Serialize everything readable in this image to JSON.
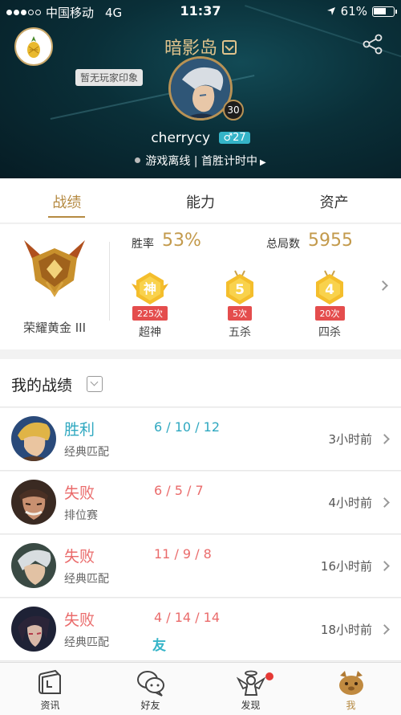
{
  "status_bar": {
    "carrier": "中国移动",
    "network": "4G",
    "time": "11:37",
    "battery": "61%"
  },
  "profile": {
    "player_name": "暗影岛",
    "impression_tag": "暂无玩家印象",
    "level": "30",
    "username": "cherrycy",
    "gender_symbol": "♂",
    "age": "27",
    "status_text": "游戏离线 | 首胜计时中"
  },
  "tabs": [
    {
      "label": "战绩"
    },
    {
      "label": "能力"
    },
    {
      "label": "资产"
    }
  ],
  "summary": {
    "rank_name": "荣耀黄金 III",
    "win_rate_label": "胜率",
    "win_rate": "53%",
    "total_games_label": "总局数",
    "total_games": "5955",
    "medals": [
      {
        "glyph": "神",
        "count": "225次",
        "label": "超神"
      },
      {
        "glyph": "5",
        "count": "5次",
        "label": "五杀"
      },
      {
        "glyph": "4",
        "count": "20次",
        "label": "四杀"
      }
    ]
  },
  "records": {
    "title": "我的战绩",
    "matches": [
      {
        "result": "胜利",
        "mode": "经典匹配",
        "kda": "6 / 10 / 12",
        "time": "3小时前"
      },
      {
        "result": "失败",
        "mode": "排位赛",
        "kda": "6 / 5 / 7",
        "time": "4小时前"
      },
      {
        "result": "失败",
        "mode": "经典匹配",
        "kda": "11 / 9 / 8",
        "time": "16小时前"
      },
      {
        "result": "失败",
        "mode": "经典匹配",
        "kda": "4 / 14 / 14",
        "time": "18小时前",
        "tag": "友"
      }
    ]
  },
  "bottom_nav": [
    {
      "label": "资讯",
      "icon": "news-book-icon"
    },
    {
      "label": "好友",
      "icon": "friends-chat-icon"
    },
    {
      "label": "发现",
      "icon": "discover-angel-icon"
    },
    {
      "label": "我",
      "icon": "me-poro-icon"
    }
  ],
  "colors": {
    "accent_gold": "#b58a42",
    "win": "#2fa8c0",
    "loss": "#ea6b6b",
    "badge_red": "#e44d4d"
  }
}
